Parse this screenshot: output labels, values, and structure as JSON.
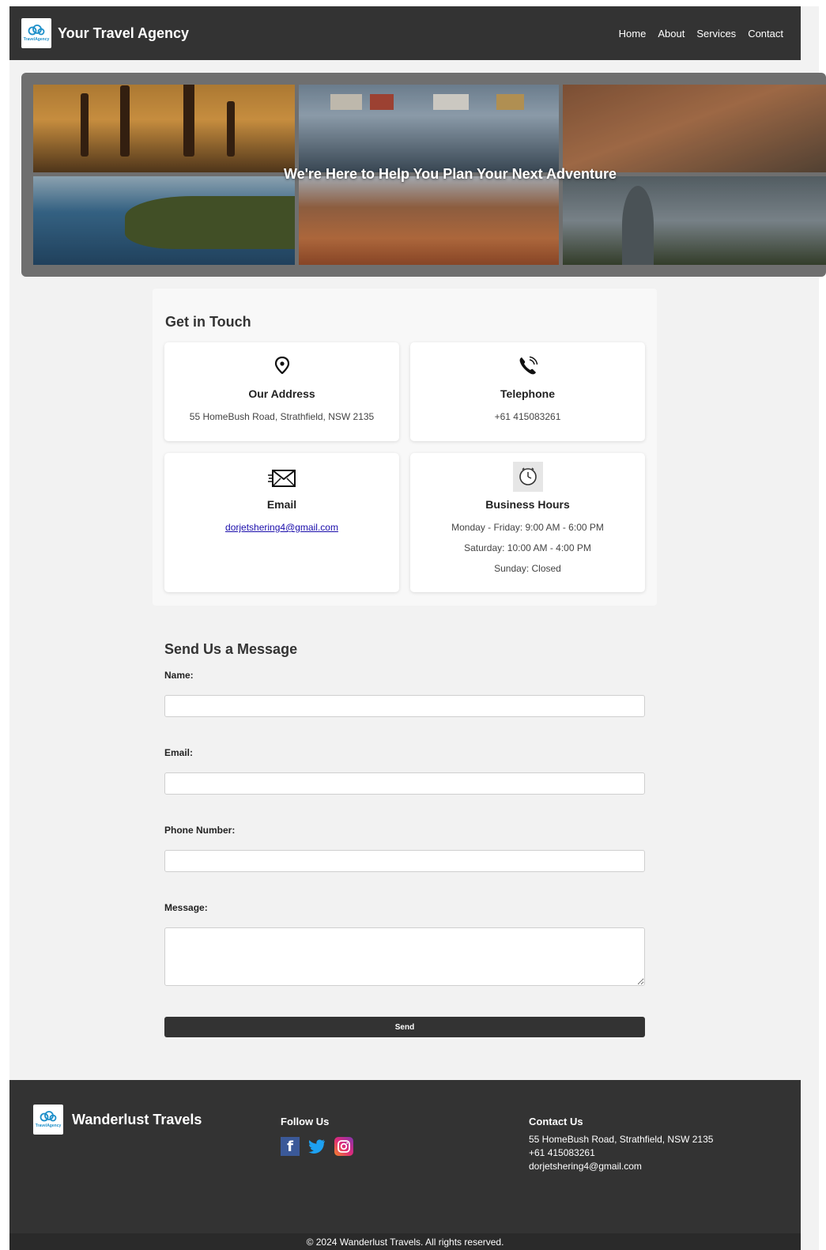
{
  "header": {
    "logo_text": "TravelAgency",
    "title": "Your Travel Agency",
    "nav": [
      "Home",
      "About",
      "Services",
      "Contact"
    ]
  },
  "hero": {
    "title": "We're Here to Help You Plan Your Next Adventure"
  },
  "touch": {
    "title": "Get in Touch",
    "cards": [
      {
        "icon": "location-pin-icon",
        "title": "Our Address",
        "lines": [
          "55 HomeBush Road, Strathfield, NSW 2135"
        ]
      },
      {
        "icon": "phone-icon",
        "title": "Telephone",
        "lines": [
          "+61 415083261"
        ]
      },
      {
        "icon": "email-icon",
        "title": "Email",
        "lines": [
          "dorjetshering4@gmail.com"
        ]
      },
      {
        "icon": "clock-icon",
        "title": "Business Hours",
        "lines": [
          "Monday - Friday: 9:00 AM - 6:00 PM",
          "Saturday: 10:00 AM - 4:00 PM",
          "Sunday: Closed"
        ]
      }
    ]
  },
  "form": {
    "title": "Send Us a Message",
    "name_label": "Name:",
    "email_label": "Email:",
    "phone_label": "Phone Number:",
    "message_label": "Message:",
    "name_value": "",
    "email_value": "",
    "phone_value": "",
    "message_value": "",
    "send_label": "Send"
  },
  "footer": {
    "logo_text": "TravelAgency",
    "brand": "Wanderlust Travels",
    "follow_title": "Follow Us",
    "socials": [
      "facebook-icon",
      "twitter-icon",
      "instagram-icon"
    ],
    "contact_title": "Contact Us",
    "contact_address": "55 HomeBush Road, Strathfield, NSW 2135",
    "contact_phone": "+61 415083261",
    "contact_email": "dorjetshering4@gmail.com",
    "copyright": "© 2024 Wanderlust Travels. All rights reserved."
  },
  "colors": {
    "header_bg": "#333333",
    "page_bg": "#f2f2f2",
    "link": "#1a0dab",
    "brand_blue": "#1d8fc9"
  }
}
